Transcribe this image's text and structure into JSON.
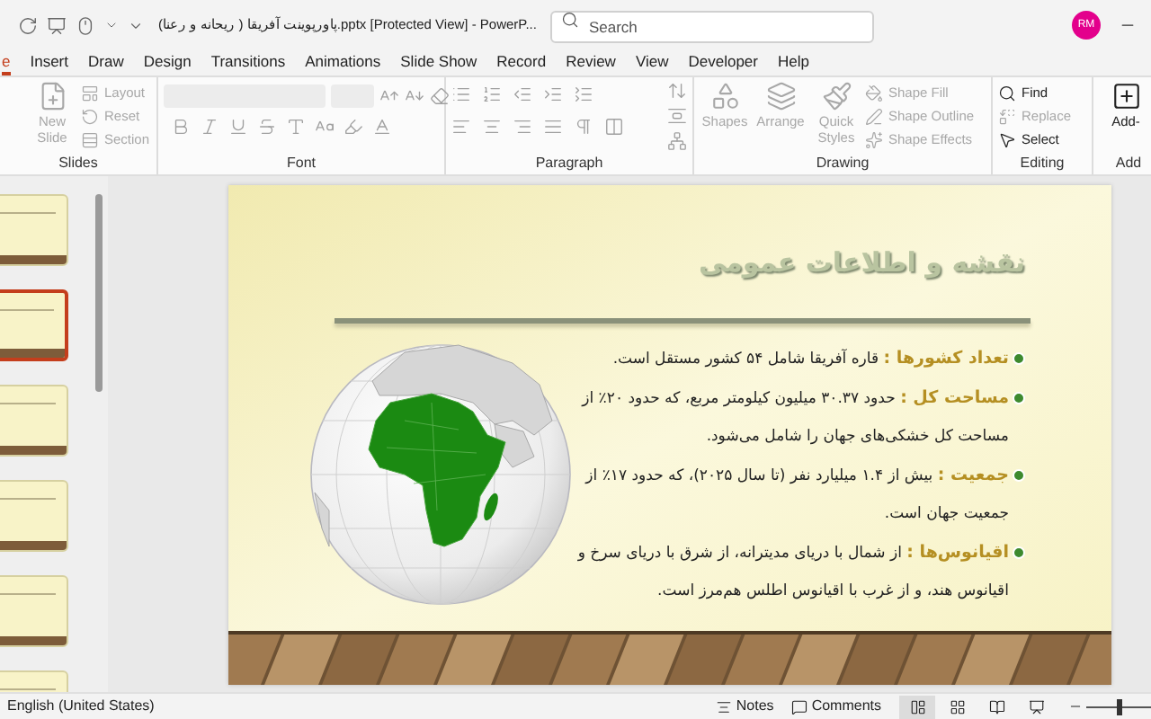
{
  "title_bar": {
    "title": "پاورپوینت آفریقا ( ریحانه و رعنا).pptx [Protected View]  -  PowerP...",
    "search": {
      "placeholder": "Search"
    },
    "avatar": "RM"
  },
  "tabs": [
    {
      "label": "e",
      "selected": true
    },
    {
      "label": "Insert",
      "selected": false
    },
    {
      "label": "Draw",
      "selected": false
    },
    {
      "label": "Design",
      "selected": false
    },
    {
      "label": "Transitions",
      "selected": false
    },
    {
      "label": "Animations",
      "selected": false
    },
    {
      "label": "Slide Show",
      "selected": false
    },
    {
      "label": "Record",
      "selected": false
    },
    {
      "label": "Review",
      "selected": false
    },
    {
      "label": "View",
      "selected": false
    },
    {
      "label": "Developer",
      "selected": false
    },
    {
      "label": "Help",
      "selected": false
    }
  ],
  "ribbon": {
    "groups": [
      {
        "label": "Slides",
        "buttons": [
          {
            "label": "New Slide",
            "disabled": true
          },
          {
            "label": "Layout",
            "disabled": true
          },
          {
            "label": "Reset",
            "disabled": true
          },
          {
            "label": "Section",
            "disabled": true
          }
        ]
      },
      {
        "label": "Font"
      },
      {
        "label": "Paragraph"
      },
      {
        "label": "Drawing",
        "buttons": [
          {
            "label": "Shapes",
            "disabled": true
          },
          {
            "label": "Arrange",
            "disabled": true
          },
          {
            "label": "Quick Styles",
            "disabled": true
          },
          {
            "label": "Shape Fill",
            "disabled": true
          },
          {
            "label": "Shape Outline",
            "disabled": true
          },
          {
            "label": "Shape Effects",
            "disabled": true
          }
        ]
      },
      {
        "label": "Editing",
        "buttons": [
          {
            "label": "Find",
            "disabled": false
          },
          {
            "label": "Replace",
            "disabled": true
          },
          {
            "label": "Select",
            "disabled": false
          }
        ]
      },
      {
        "label": "Add",
        "buttons": [
          {
            "label": "Add-",
            "disabled": false
          }
        ]
      }
    ]
  },
  "thumbnails": [
    {
      "selected": false
    },
    {
      "selected": true
    },
    {
      "selected": false
    },
    {
      "selected": false
    },
    {
      "selected": false
    },
    {
      "selected": false
    }
  ],
  "slide": {
    "title": "نقشه و اطلاعات عمومی",
    "bullets": [
      {
        "text": "**تعداد کشورها :** قاره آفریقا شامل ۵۴ کشور مستقل است."
      },
      {
        "text": "**مساحت کل :** حدود ۳۰.۳۷ میلیون کیلومتر مربع، که حدود ۲۰٪ از مساحت کل خشکی‌های جهان را شامل می‌شود."
      },
      {
        "text": "**جمعیت :** بیش از ۱.۴ میلیارد نفر (تا سال ۲۰۲۵)، که حدود ۱۷٪ از جمعیت جهان است."
      },
      {
        "text": "**اقیانوس‌ها :** از شمال با دریای مدیترانه، از شرق با دریای سرخ و اقیانوس هند، و از غرب با اقیانوس اطلس هم‌مرز است."
      }
    ]
  },
  "status_bar": {
    "language": "English (United States)",
    "notes": "Notes",
    "comments": "Comments",
    "views": [
      {
        "selected": true
      },
      {
        "selected": false
      },
      {
        "selected": false
      },
      {
        "selected": false
      }
    ],
    "zoom": {
      "level": 0.5
    }
  }
}
